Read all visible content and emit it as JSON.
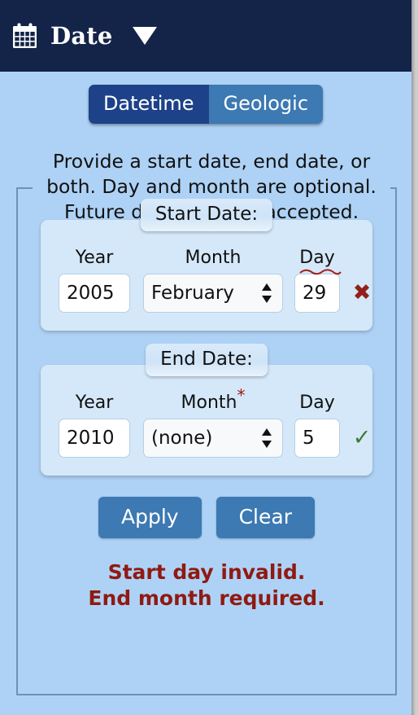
{
  "header": {
    "icon": "calendar-icon",
    "title": "Date",
    "caret": "chevron-down-icon"
  },
  "tabs": [
    {
      "label": "Datetime",
      "active": true
    },
    {
      "label": "Geologic",
      "active": false
    }
  ],
  "instructions": "Provide a start date, end date, or both. Day and month are optional. Future dates are not accepted.",
  "sections": [
    {
      "legend": "Start Date:",
      "year": {
        "label": "Year",
        "value": "2005"
      },
      "month": {
        "label": "Month",
        "required": false,
        "value": "February"
      },
      "day": {
        "label": "Day",
        "value": "29",
        "invalid": true
      },
      "status": {
        "icon": "invalid-cross-icon",
        "glyph": "✖",
        "state": "invalid"
      }
    },
    {
      "legend": "End Date:",
      "year": {
        "label": "Year",
        "value": "2010"
      },
      "month": {
        "label": "Month",
        "required": true,
        "required_mark": "*",
        "value": "(none)"
      },
      "day": {
        "label": "Day",
        "value": "5",
        "invalid": false
      },
      "status": {
        "icon": "valid-check-icon",
        "glyph": "✓",
        "state": "valid"
      }
    }
  ],
  "buttons": {
    "apply": "Apply",
    "clear": "Clear"
  },
  "errors": {
    "line1": "Start day invalid.",
    "line2": "End month required."
  },
  "colors": {
    "header_bg": "#142449",
    "page_bg": "#aed2f5",
    "panel_bg": "#d4e8f9",
    "tab_active": "#1e4289",
    "tab_inactive": "#3d79b2",
    "button": "#3d79b2",
    "error_text": "#8f1a12",
    "valid_green": "#3f7a2e",
    "border": "#6f91b4"
  }
}
